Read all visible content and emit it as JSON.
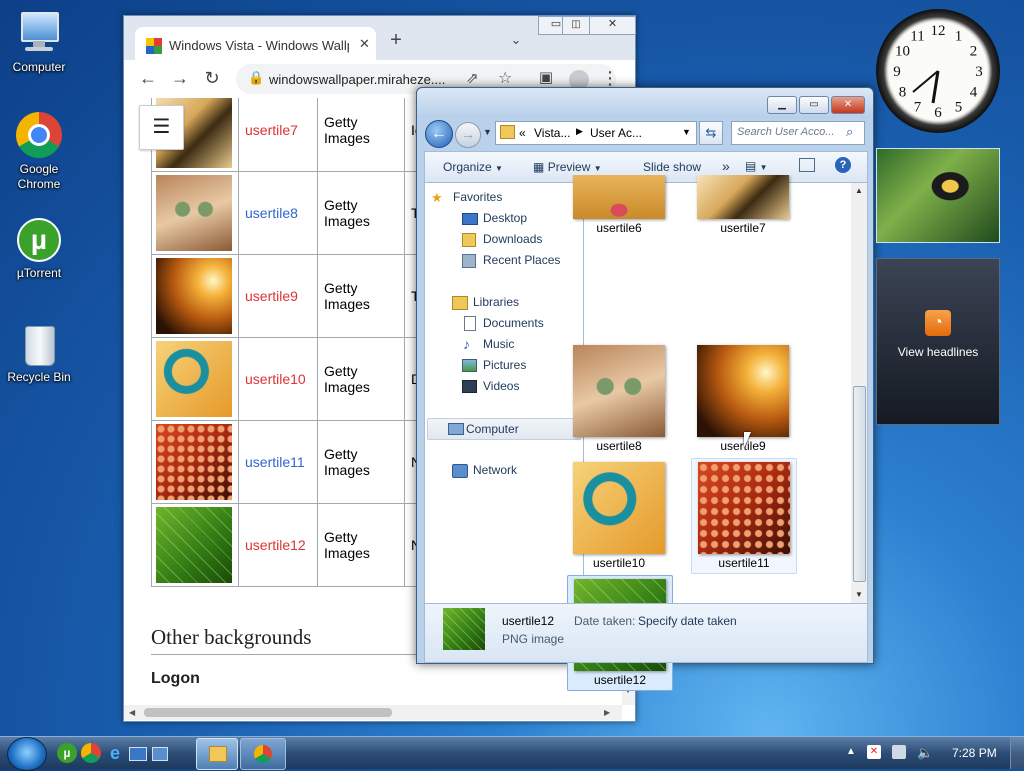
{
  "desktop": {
    "icons": [
      {
        "label": "Computer"
      },
      {
        "label": "Google Chrome"
      },
      {
        "label": "µTorrent"
      },
      {
        "label": "Recycle Bin"
      }
    ]
  },
  "chrome": {
    "tab_title": "Windows Vista - Windows Wallp",
    "tab_close": "✕",
    "new_tab": "+",
    "url": "windowswallpaper.miraheze....",
    "rows": [
      {
        "name": "usertile7",
        "source_line1": "Getty",
        "source_line2": "Images",
        "extra": "Ic",
        "link_color": "red"
      },
      {
        "name": "usertile8",
        "source_line1": "Getty",
        "source_line2": "Images",
        "extra": "To",
        "link_color": "blue"
      },
      {
        "name": "usertile9",
        "source_line1": "Getty",
        "source_line2": "Images",
        "extra": "To",
        "link_color": "red"
      },
      {
        "name": "usertile10",
        "source_line1": "Getty",
        "source_line2": "Images",
        "extra": "D",
        "link_color": "red"
      },
      {
        "name": "usertile11",
        "source_line1": "Getty",
        "source_line2": "Images",
        "extra": "N",
        "link_color": "blue"
      },
      {
        "name": "usertile12",
        "source_line1": "Getty",
        "source_line2": "Images",
        "extra": "N",
        "link_color": "red"
      }
    ],
    "section_heading": "Other backgrounds",
    "subheading": "Logon"
  },
  "explorer": {
    "breadcrumb_prefix": "«",
    "breadcrumb_1": "Vista...",
    "breadcrumb_2": "User Ac...",
    "search_placeholder": "Search User Acco...",
    "cmd_organize": "Organize",
    "cmd_preview": "Preview",
    "cmd_slideshow": "Slide show",
    "cmd_more": "»",
    "nav": {
      "favorites": "Favorites",
      "desktop": "Desktop",
      "downloads": "Downloads",
      "recent": "Recent Places",
      "libraries": "Libraries",
      "documents": "Documents",
      "music": "Music",
      "pictures": "Pictures",
      "videos": "Videos",
      "computer": "Computer",
      "network": "Network"
    },
    "files": [
      "usertile6",
      "usertile7",
      "usertile8",
      "usertile9",
      "usertile10",
      "usertile11",
      "usertile12"
    ],
    "details_name": "usertile12",
    "details_type": "PNG image",
    "details_date_label": "Date taken:",
    "details_date_value": "Specify date taken"
  },
  "gadgets": {
    "clock_numbers": [
      "12",
      "1",
      "2",
      "3",
      "4",
      "5",
      "6",
      "7",
      "8",
      "9",
      "10",
      "11"
    ],
    "feed_label": "View headlines"
  },
  "taskbar": {
    "time": "7:28 PM"
  }
}
